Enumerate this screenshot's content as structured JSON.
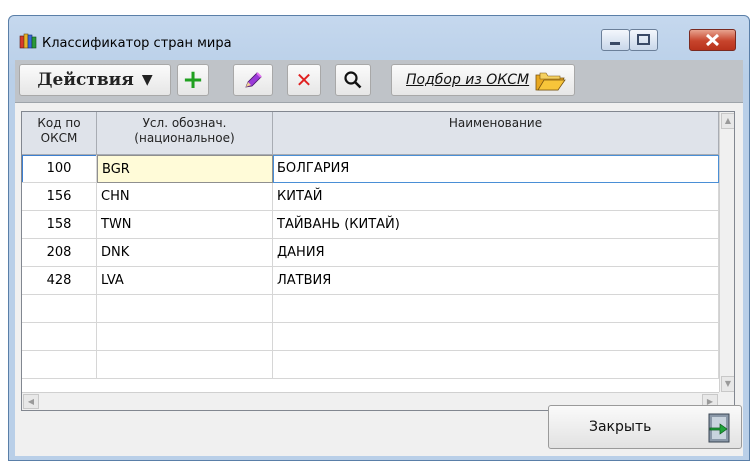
{
  "window": {
    "title": "Классификатор стран мира",
    "icons": {
      "app": "books-icon",
      "minimize": "minimize-icon",
      "maximize": "maximize-icon",
      "close": "close-icon"
    },
    "colors": {
      "title_bar": "#c5d8ee",
      "close_button": "#c7442c"
    }
  },
  "toolbar": {
    "actions_label": "Действия",
    "actions_arrow": "▼",
    "add_icon": "+",
    "delete_icon": "✕",
    "pick_label": "Подбор из ОКСМ",
    "icons": {
      "edit": "pencil-icon",
      "find": "search-icon",
      "pick": "folder-icon"
    }
  },
  "grid": {
    "columns": [
      {
        "label": "Код по ОКСМ"
      },
      {
        "label": "Усл. обознач. (национальное)"
      },
      {
        "label": "Наименование"
      }
    ],
    "rows": [
      {
        "code": "100",
        "abbr": "BGR",
        "name": "БОЛГАРИЯ"
      },
      {
        "code": "156",
        "abbr": "CHN",
        "name": "КИТАЙ"
      },
      {
        "code": "158",
        "abbr": "TWN",
        "name": "ТАЙВАНЬ (КИТАЙ)"
      },
      {
        "code": "208",
        "abbr": "DNK",
        "name": "ДАНИЯ"
      },
      {
        "code": "428",
        "abbr": "LVA",
        "name": "ЛАТВИЯ"
      }
    ],
    "selected_row": 0,
    "colors": {
      "selected_cell": "#fffbd8",
      "header": "#dfe3ea"
    }
  },
  "footer": {
    "close_label": "Закрыть",
    "close_icon": "exit-door-icon"
  }
}
